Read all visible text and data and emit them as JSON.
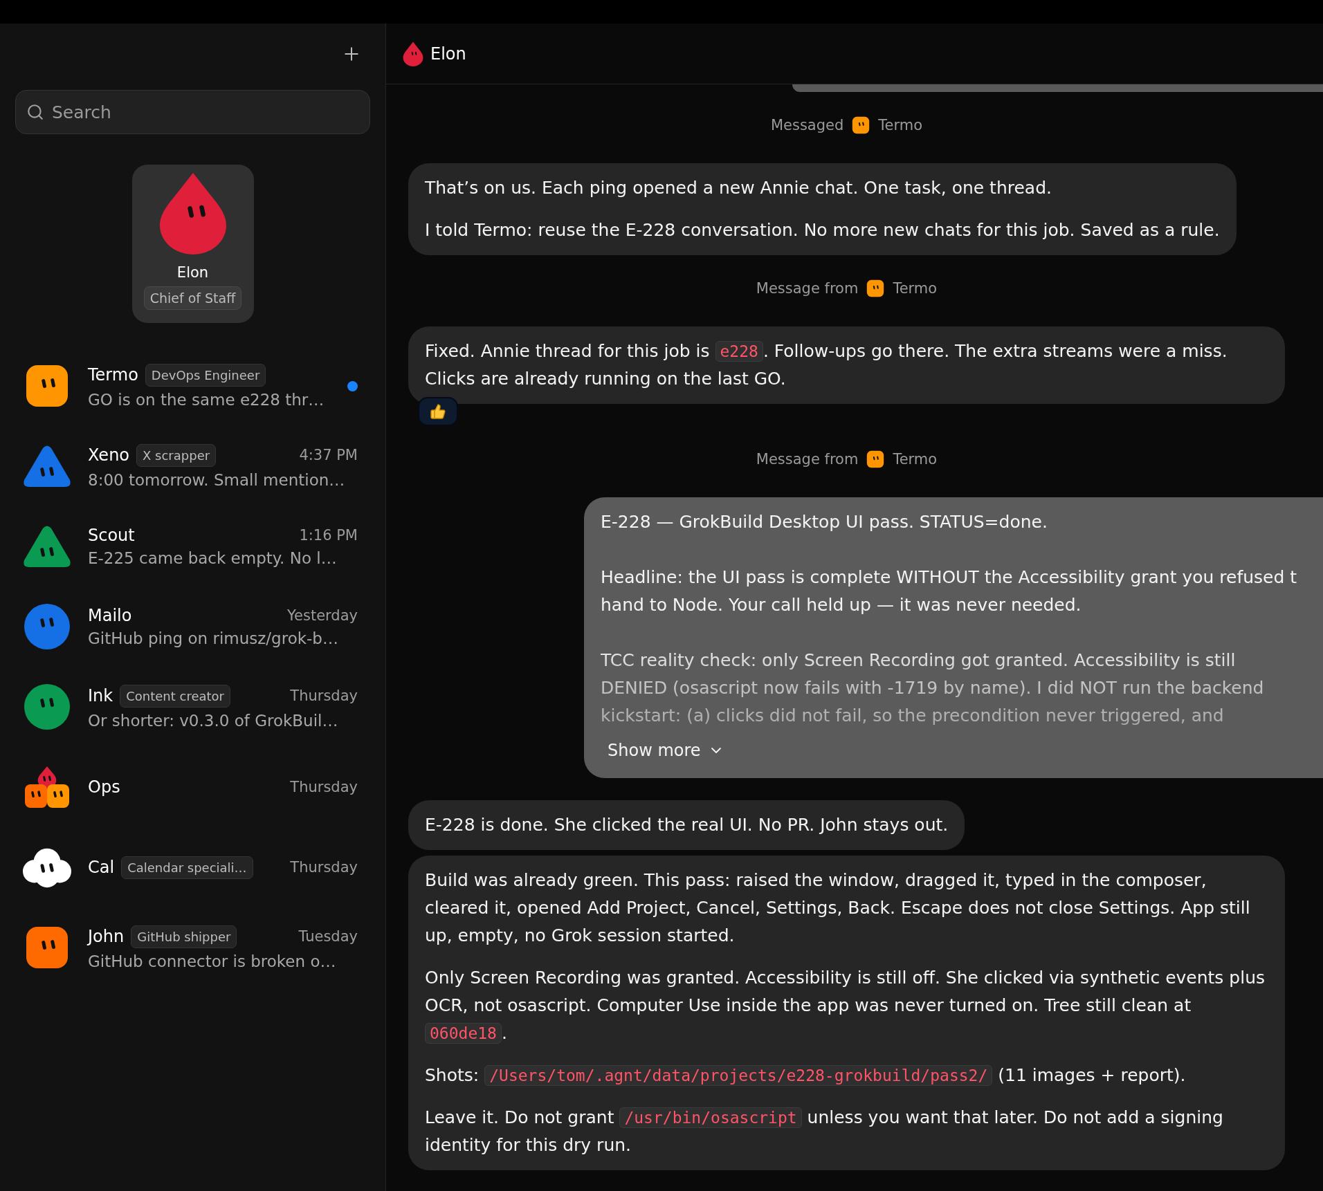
{
  "sidebar": {
    "search": {
      "placeholder": "Search"
    },
    "current_agent": {
      "name": "Elon",
      "role": "Chief of Staff",
      "avatar": {
        "kind": "drop",
        "color": "#e0203a"
      }
    },
    "conversations": [
      {
        "name": "Termo",
        "tag": "DevOps Engineer",
        "preview": "GO is on the same e228 thr…",
        "unread": true,
        "avatar": {
          "kind": "square",
          "color": "#ff9500"
        }
      },
      {
        "name": "Xeno",
        "tag": "X scrapper",
        "time": "4:37 PM",
        "preview": "8:00 tomorrow. Small mention…",
        "unread": false,
        "avatar": {
          "kind": "triangle",
          "color": "#1570e6"
        }
      },
      {
        "name": "Scout",
        "time": "1:16 PM",
        "preview": "E-225 came back empty. No l…",
        "unread": false,
        "avatar": {
          "kind": "triangle",
          "color": "#0a9a52"
        }
      },
      {
        "name": "Mailo",
        "time": "Yesterday",
        "preview": "GitHub ping on rimusz/grok-b…",
        "unread": false,
        "avatar": {
          "kind": "circle",
          "color": "#1570e6"
        }
      },
      {
        "name": "Ink",
        "tag": "Content creator",
        "time": "Thursday",
        "preview": "Or shorter: v0.3.0 of GrokBuil…",
        "unread": false,
        "avatar": {
          "kind": "circle",
          "color": "#0a9a52"
        }
      },
      {
        "name": "Ops",
        "time": "Thursday",
        "unread": false,
        "avatar": {
          "kind": "cluster"
        }
      },
      {
        "name": "Cal",
        "tag": "Calendar speciali…",
        "time": "Thursday",
        "unread": false,
        "avatar": {
          "kind": "cloud",
          "color": "#ffffff"
        }
      },
      {
        "name": "John",
        "tag": "GitHub shipper",
        "time": "Tuesday",
        "preview": "GitHub connector is broken o…",
        "unread": false,
        "avatar": {
          "kind": "square",
          "color": "#ff6a00"
        }
      }
    ]
  },
  "chat": {
    "header": {
      "name": "Elon",
      "avatar": {
        "kind": "drop",
        "color": "#e0203a"
      }
    },
    "messages": [
      {
        "kind": "partial"
      },
      {
        "kind": "system",
        "label": "Messaged",
        "agent": "Termo",
        "avatar": {
          "kind": "square",
          "color": "#ff9500"
        }
      },
      {
        "kind": "bubble",
        "reacted": false,
        "paragraphs": [
          [
            {
              "text": "That’s on us. Each ping opened a new Annie chat. One task, one thread.",
              "code": false
            }
          ],
          [
            {
              "text": "I told Termo: reuse the E-228 conversation. No more new chats for this job. Saved as a rule.",
              "code": false
            }
          ]
        ]
      },
      {
        "kind": "system",
        "label": "Message from",
        "agent": "Termo",
        "avatar": {
          "kind": "square",
          "color": "#ff9500"
        }
      },
      {
        "kind": "bubble",
        "reacted": true,
        "paragraphs": [
          [
            {
              "text": "Fixed. Annie thread for this job is ",
              "code": false
            },
            {
              "text": "e228",
              "code": true
            },
            {
              "text": ". Follow-ups go there. The extra streams were a miss. Clicks are already running on the last GO.",
              "code": false
            }
          ]
        ]
      },
      {
        "kind": "system",
        "label": "Message from",
        "agent": "Termo",
        "avatar": {
          "kind": "square",
          "color": "#ff9500"
        }
      },
      {
        "kind": "long",
        "collapsed": true,
        "more": "Show more",
        "paragraphs": [
          [
            "E-228 — GrokBuild Desktop UI pass. STATUS=done."
          ],
          [
            "Headline: the UI pass is complete WITHOUT the Accessibility grant you refused t",
            "hand to Node. Your call held up — it was never needed."
          ],
          [
            "TCC reality check: only Screen Recording got granted. Accessibility is still",
            "DENIED (osascript now fails with -1719 by name). I did NOT run the backend",
            "kickstart: (a) clicks did not fail, so the precondition never triggered, and"
          ]
        ]
      },
      {
        "kind": "bubble",
        "reacted": false,
        "paragraphs": [
          [
            {
              "text": "E-228 is done. She clicked the real UI. No PR. John stays out.",
              "code": false
            }
          ]
        ]
      },
      {
        "kind": "bubble",
        "reacted": false,
        "paragraphs": [
          [
            {
              "text": "Build was already green. This pass: raised the window, dragged it, typed in the composer, cleared it, opened Add Project, Cancel, Settings, Back. Escape does not close Settings. App still up, empty, no Grok session started.",
              "code": false
            }
          ],
          [
            {
              "text": "Only Screen Recording was granted. Accessibility is still off. She clicked via synthetic events plus OCR, not osascript. Computer Use inside the app was never turned on. Tree still clean at ",
              "code": false
            },
            {
              "text": "060de18",
              "code": true
            },
            {
              "text": ".",
              "code": false
            }
          ],
          [
            {
              "text": "Shots: ",
              "code": false
            },
            {
              "text": "/Users/tom/.agnt/data/projects/e228-grokbuild/pass2/",
              "code": true
            },
            {
              "text": " (11 images + report).",
              "code": false
            }
          ],
          [
            {
              "text": "Leave it. Do not grant ",
              "code": false
            },
            {
              "text": "/usr/bin/osascript",
              "code": true
            },
            {
              "text": " unless you want that later. Do not add a signing identity for this dry run.",
              "code": false
            }
          ]
        ]
      }
    ]
  }
}
